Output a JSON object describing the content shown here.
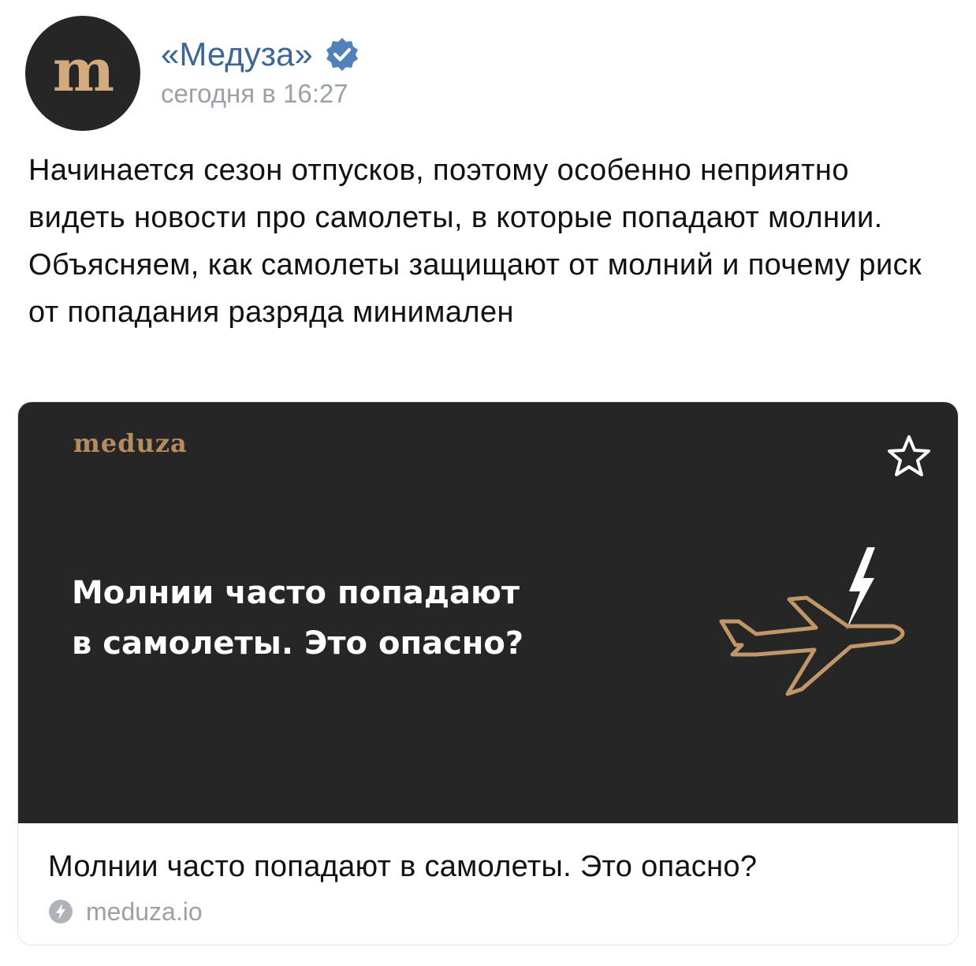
{
  "author": {
    "avatar_letter": "m",
    "name": "«Медуза»",
    "verified_icon": "verified-badge-icon",
    "time": "сегодня в 16:27"
  },
  "post": {
    "text": "Начинается сезон отпусков, поэтому особенно неприятно видеть новости про самолеты, в которые попадают молнии. Объясняем, как самолеты защищают от молний и почему риск от попадания разряда минимален"
  },
  "link_card": {
    "image": {
      "logo": "meduza",
      "headline_line1": "Молнии часто попадают",
      "headline_line2": "в самолеты. Это опасно?",
      "background_color": "#262626",
      "accent_color": "#c1976a",
      "bookmark_icon": "star-outline-icon",
      "illustration_icon": "airplane-lightning-icon"
    },
    "title": "Молнии часто попадают в самолеты. Это опасно?",
    "source_icon": "lightning-circle-icon",
    "domain": "meduza.io"
  },
  "colors": {
    "author_name": "#3c6696",
    "muted_text": "#9aa1a8",
    "verified": "#5181b8",
    "body_text": "#111111"
  }
}
